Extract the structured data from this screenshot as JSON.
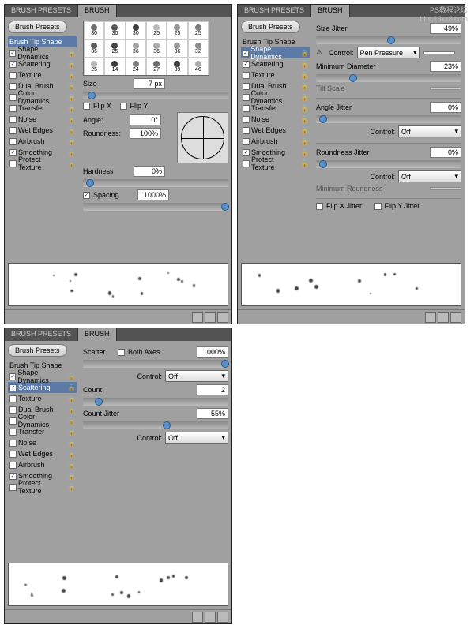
{
  "tabs": {
    "presets": "BRUSH PRESETS",
    "brush": "BRUSH"
  },
  "presetsBtn": "Brush Presets",
  "sidebar": [
    {
      "label": "Brush Tip Shape",
      "cb": false,
      "hi": false,
      "nocb": true
    },
    {
      "label": "Shape Dynamics",
      "cb": true,
      "hi": false
    },
    {
      "label": "Scattering",
      "cb": true,
      "hi": false
    },
    {
      "label": "Texture",
      "cb": false,
      "hi": false
    },
    {
      "label": "Dual Brush",
      "cb": false,
      "hi": false
    },
    {
      "label": "Color Dynamics",
      "cb": false,
      "hi": false
    },
    {
      "label": "Transfer",
      "cb": false,
      "hi": false
    },
    {
      "label": "Noise",
      "cb": false,
      "hi": false
    },
    {
      "label": "Wet Edges",
      "cb": false,
      "hi": false
    },
    {
      "label": "Airbrush",
      "cb": false,
      "hi": false
    },
    {
      "label": "Smoothing",
      "cb": true,
      "hi": false
    },
    {
      "label": "Protect Texture",
      "cb": false,
      "hi": false
    }
  ],
  "p1": {
    "hi": 0,
    "thumbs": [
      30,
      30,
      30,
      25,
      25,
      25,
      36,
      25,
      36,
      36,
      36,
      32,
      25,
      14,
      24,
      27,
      39,
      46
    ],
    "size": {
      "label": "Size",
      "value": "7 px"
    },
    "flipX": "Flip X",
    "flipY": "Flip Y",
    "angle": {
      "label": "Angle:",
      "value": "0°"
    },
    "round": {
      "label": "Roundness:",
      "value": "100%"
    },
    "hard": {
      "label": "Hardness",
      "value": "0%"
    },
    "spacing": {
      "label": "Spacing",
      "value": "1000%",
      "cb": true
    }
  },
  "p2": {
    "hi": 1,
    "sizeJitter": {
      "label": "Size Jitter",
      "value": "49%"
    },
    "control": "Control:",
    "ctrl1": "Pen Pressure",
    "minDiam": {
      "label": "Minimum Diameter",
      "value": "23%"
    },
    "tiltScale": "Tilt Scale",
    "angleJitter": {
      "label": "Angle Jitter",
      "value": "0%"
    },
    "ctrl2": "Off",
    "roundJitter": {
      "label": "Roundness Jitter",
      "value": "0%"
    },
    "ctrl3": "Off",
    "minRound": "Minimum Roundness",
    "flipXJ": "Flip X Jitter",
    "flipYJ": "Flip Y Jitter"
  },
  "p3": {
    "hi": 2,
    "scatter": {
      "label": "Scatter",
      "both": "Both Axes",
      "value": "1000%"
    },
    "ctrl1": "Off",
    "count": {
      "label": "Count",
      "value": "2"
    },
    "countJitter": {
      "label": "Count Jitter",
      "value": "55%"
    },
    "ctrl2": "Off",
    "control": "Control:"
  },
  "watermark": "PS教程论坛\nbbs.16xx8.com"
}
